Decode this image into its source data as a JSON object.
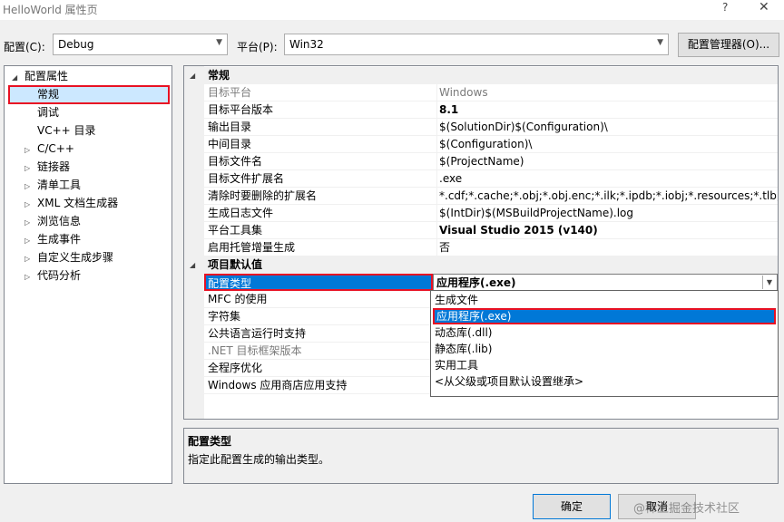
{
  "window": {
    "title": "HelloWorld 属性页",
    "help": "?",
    "close": "✕"
  },
  "toolbar": {
    "config_label": "配置(C):",
    "config_value": "Debug",
    "platform_label": "平台(P):",
    "platform_value": "Win32",
    "config_manager": "配置管理器(O)..."
  },
  "tree": {
    "root": "配置属性",
    "items": [
      {
        "label": "常规",
        "expander": false
      },
      {
        "label": "调试",
        "expander": false
      },
      {
        "label": "VC++ 目录",
        "expander": false
      },
      {
        "label": "C/C++",
        "expander": true
      },
      {
        "label": "链接器",
        "expander": true
      },
      {
        "label": "清单工具",
        "expander": true
      },
      {
        "label": "XML 文档生成器",
        "expander": true
      },
      {
        "label": "浏览信息",
        "expander": true
      },
      {
        "label": "生成事件",
        "expander": true
      },
      {
        "label": "自定义生成步骤",
        "expander": true
      },
      {
        "label": "代码分析",
        "expander": true
      }
    ]
  },
  "grid": {
    "cat1": "常规",
    "rows1": [
      {
        "name": "目标平台",
        "value": "Windows",
        "grey": true,
        "bold": false
      },
      {
        "name": "目标平台版本",
        "value": "8.1",
        "grey": false,
        "bold": true
      },
      {
        "name": "输出目录",
        "value": "$(SolutionDir)$(Configuration)\\",
        "grey": false,
        "bold": false
      },
      {
        "name": "中间目录",
        "value": "$(Configuration)\\",
        "grey": false,
        "bold": false
      },
      {
        "name": "目标文件名",
        "value": "$(ProjectName)",
        "grey": false,
        "bold": false
      },
      {
        "name": "目标文件扩展名",
        "value": ".exe",
        "grey": false,
        "bold": false
      },
      {
        "name": "清除时要删除的扩展名",
        "value": "*.cdf;*.cache;*.obj;*.obj.enc;*.ilk;*.ipdb;*.iobj;*.resources;*.tlb;*.tli;*.t",
        "grey": false,
        "bold": false
      },
      {
        "name": "生成日志文件",
        "value": "$(IntDir)$(MSBuildProjectName).log",
        "grey": false,
        "bold": false
      },
      {
        "name": "平台工具集",
        "value": "Visual Studio 2015 (v140)",
        "grey": false,
        "bold": true
      },
      {
        "name": "启用托管增量生成",
        "value": "否",
        "grey": false,
        "bold": false
      }
    ],
    "cat2": "项目默认值",
    "selected": {
      "name": "配置类型",
      "value": "应用程序(.exe)"
    },
    "rows2": [
      {
        "name": "MFC 的使用",
        "grey": false
      },
      {
        "name": "字符集",
        "grey": false
      },
      {
        "name": "公共语言运行时支持",
        "grey": false
      },
      {
        "name": ".NET 目标框架版本",
        "grey": true
      },
      {
        "name": "全程序优化",
        "grey": false
      },
      {
        "name": "Windows 应用商店应用支持",
        "grey": false
      }
    ]
  },
  "dropdown": {
    "options": [
      {
        "label": "生成文件",
        "selected": false
      },
      {
        "label": "应用程序(.exe)",
        "selected": true
      },
      {
        "label": "动态库(.dll)",
        "selected": false
      },
      {
        "label": "静态库(.lib)",
        "selected": false
      },
      {
        "label": "实用工具",
        "selected": false
      },
      {
        "label": "<从父级或项目默认设置继承>",
        "selected": false
      }
    ]
  },
  "description": {
    "title": "配置类型",
    "text": "指定此配置生成的输出类型。"
  },
  "buttons": {
    "ok": "确定",
    "cancel": "取消"
  },
  "watermark": "@稀土掘金技术社区"
}
